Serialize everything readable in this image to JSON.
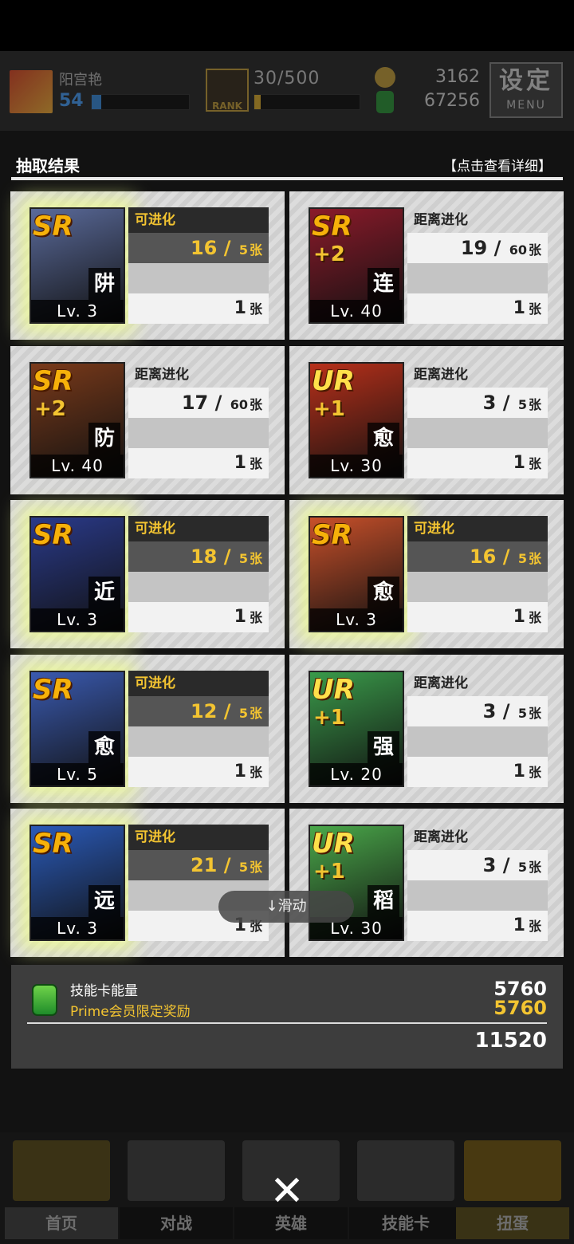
{
  "topbar": {
    "player_name": "阳宫艳",
    "player_level": "54",
    "rank_text": "30/500",
    "rank_icon_label": "RANK",
    "coins": "3162",
    "energy": "67256",
    "menu_big": "设定",
    "menu_small": "MENU"
  },
  "section": {
    "title": "抽取结果",
    "detail_link": "【点击查看详细】"
  },
  "cards": [
    {
      "rarity": "SR",
      "plus": "",
      "role": "阱",
      "level": "Lv. 3",
      "status": "可进化",
      "current": "16",
      "target": "5",
      "unit": "张",
      "count": "1",
      "bg": "#5a6a9a"
    },
    {
      "rarity": "SR",
      "plus": "+2",
      "role": "连",
      "level": "Lv. 40",
      "status": "距离进化",
      "current": "19",
      "target": "60",
      "unit": "张",
      "count": "1",
      "bg": "#8a1a2a"
    },
    {
      "rarity": "SR",
      "plus": "+2",
      "role": "防",
      "level": "Lv. 40",
      "status": "距离进化",
      "current": "17",
      "target": "60",
      "unit": "张",
      "count": "1",
      "bg": "#7a3a1a"
    },
    {
      "rarity": "UR",
      "plus": "+1",
      "role": "愈",
      "level": "Lv. 30",
      "status": "距离进化",
      "current": "3",
      "target": "5",
      "unit": "张",
      "count": "1",
      "bg": "#b8301a"
    },
    {
      "rarity": "SR",
      "plus": "",
      "role": "近",
      "level": "Lv. 3",
      "status": "可进化",
      "current": "18",
      "target": "5",
      "unit": "张",
      "count": "1",
      "bg": "#2a3a8a"
    },
    {
      "rarity": "SR",
      "plus": "",
      "role": "愈",
      "level": "Lv. 3",
      "status": "可进化",
      "current": "16",
      "target": "5",
      "unit": "张",
      "count": "1",
      "bg": "#c8502a"
    },
    {
      "rarity": "SR",
      "plus": "",
      "role": "愈",
      "level": "Lv. 5",
      "status": "可进化",
      "current": "12",
      "target": "5",
      "unit": "张",
      "count": "1",
      "bg": "#3a5ab0"
    },
    {
      "rarity": "UR",
      "plus": "+1",
      "role": "强",
      "level": "Lv. 20",
      "status": "距离进化",
      "current": "3",
      "target": "5",
      "unit": "张",
      "count": "1",
      "bg": "#3a9a4a"
    },
    {
      "rarity": "SR",
      "plus": "",
      "role": "远",
      "level": "Lv. 3",
      "status": "可进化",
      "current": "21",
      "target": "5",
      "unit": "张",
      "count": "1",
      "bg": "#2a5ab8"
    },
    {
      "rarity": "UR",
      "plus": "+1",
      "role": "稻",
      "level": "Lv. 30",
      "status": "距离进化",
      "current": "3",
      "target": "5",
      "unit": "张",
      "count": "1",
      "bg": "#4aa84a"
    }
  ],
  "scroll_hint": "↓滑动",
  "summary": {
    "label": "技能卡能量",
    "prime_label": "Prime会员限定奖励",
    "value": "5760",
    "prime_value": "5760",
    "total": "11520"
  },
  "nav": [
    {
      "label": "首页"
    },
    {
      "label": "对战"
    },
    {
      "label": "英雄"
    },
    {
      "label": "技能卡"
    },
    {
      "label": "扭蛋"
    }
  ],
  "close_symbol": "✕"
}
